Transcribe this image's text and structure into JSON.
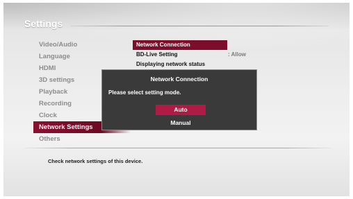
{
  "header": {
    "title": "Settings"
  },
  "menu": {
    "items": [
      {
        "label": "Video/Audio"
      },
      {
        "label": "Language"
      },
      {
        "label": "HDMI"
      },
      {
        "label": "3D settings"
      },
      {
        "label": "Playback"
      },
      {
        "label": "Recording"
      },
      {
        "label": "Clock"
      },
      {
        "label": "Network Settings"
      },
      {
        "label": "Others"
      }
    ],
    "selected": "Network Settings"
  },
  "submenu": {
    "items": [
      {
        "label": "Network Connection",
        "value": ""
      },
      {
        "label": "BD-Live Setting",
        "value": ": Allow"
      },
      {
        "label": "Displaying network status",
        "value": ""
      }
    ],
    "selected": "Network Connection"
  },
  "hint": "Check network settings of this device.",
  "dialog": {
    "title": "Network Connection",
    "message": "Please select setting mode.",
    "options": [
      {
        "label": "Auto"
      },
      {
        "label": "Manual"
      }
    ],
    "selected": "Auto"
  },
  "colors": {
    "accent": "#b01b45",
    "menu_highlight": "#7d0e2b",
    "dialog_bg": "#3a3a3a"
  }
}
